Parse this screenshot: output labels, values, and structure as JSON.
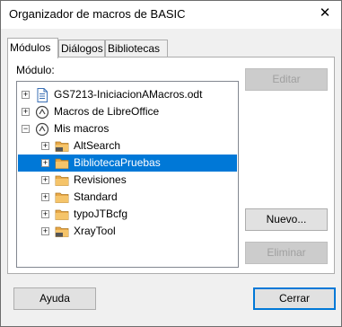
{
  "window": {
    "title": "Organizador de macros de BASIC",
    "close_glyph": "✕"
  },
  "tabs": [
    {
      "label": "Módulos",
      "active": true
    },
    {
      "label": "Diálogos",
      "active": false
    },
    {
      "label": "Bibliotecas",
      "active": false
    }
  ],
  "panel": {
    "module_label": "Módulo:"
  },
  "tree": [
    {
      "label": "GS7213-IniciacionAMacros.odt",
      "icon": "document-icon",
      "expander": "+",
      "selected": false
    },
    {
      "label": "Macros de LibreOffice",
      "icon": "macro-container-icon",
      "expander": "+",
      "selected": false
    },
    {
      "label": "Mis macros",
      "icon": "macro-container-icon",
      "expander": "−",
      "selected": false
    },
    {
      "label": "AltSearch",
      "icon": "locked-folder-icon",
      "expander": "+",
      "selected": false
    },
    {
      "label": "BibliotecaPruebas",
      "icon": "folder-icon",
      "expander": "+",
      "selected": true
    },
    {
      "label": "Revisiones",
      "icon": "folder-icon",
      "expander": "+",
      "selected": false
    },
    {
      "label": "Standard",
      "icon": "folder-icon",
      "expander": "+",
      "selected": false
    },
    {
      "label": "typoJTBcfg",
      "icon": "folder-icon",
      "expander": "+",
      "selected": false
    },
    {
      "label": "XrayTool",
      "icon": "locked-folder-icon",
      "expander": "+",
      "selected": false
    }
  ],
  "buttons": {
    "edit": "Editar",
    "new": "Nuevo...",
    "delete": "Eliminar",
    "help": "Ayuda",
    "close": "Cerrar"
  },
  "colors": {
    "selection": "#0078d7",
    "folder": "#e8a848"
  }
}
